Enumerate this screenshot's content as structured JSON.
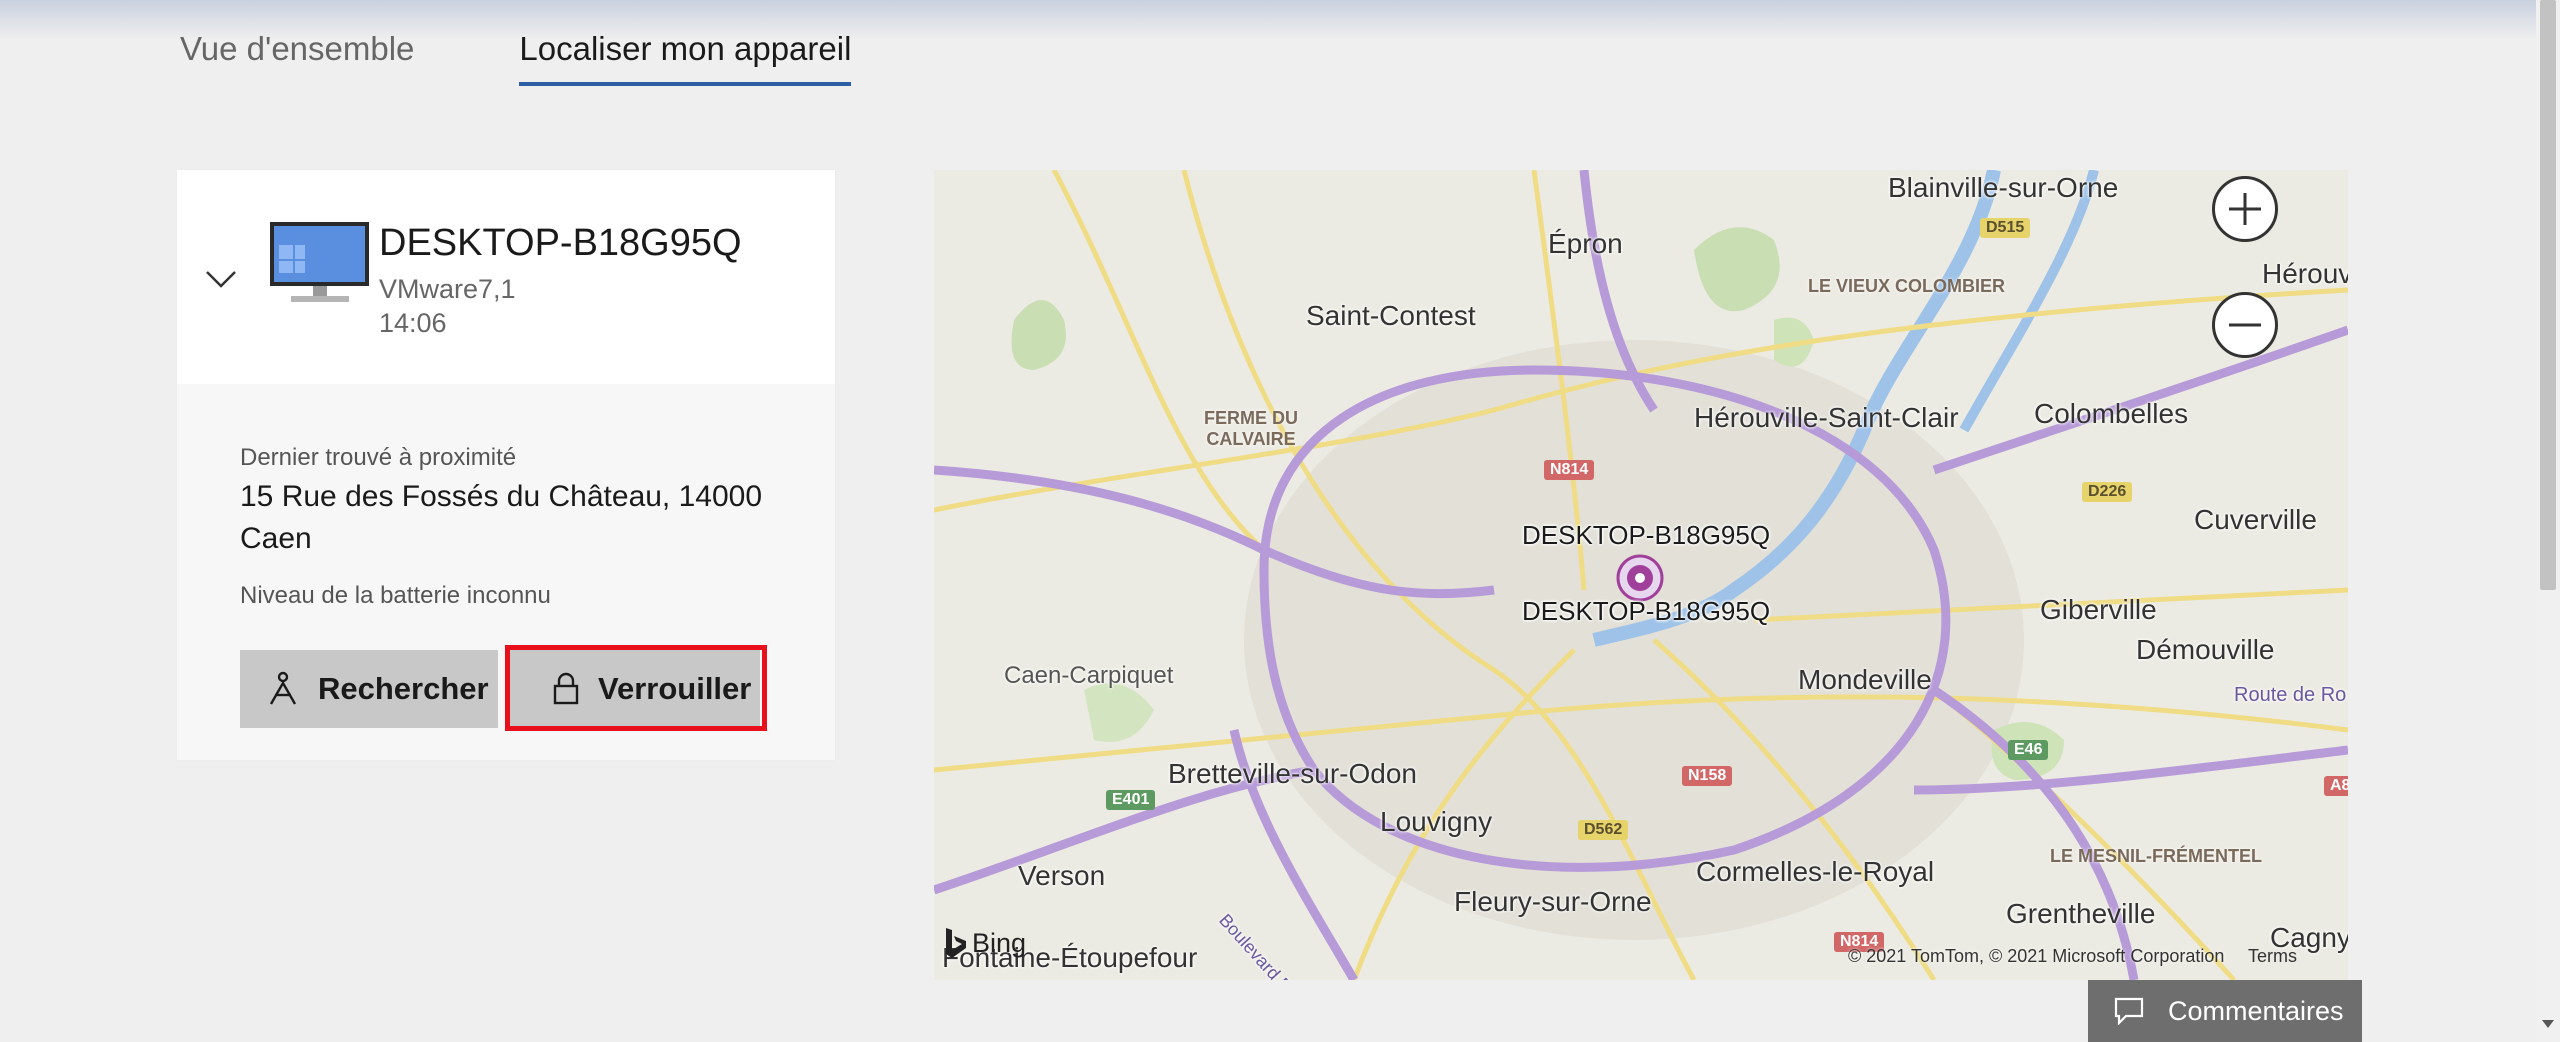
{
  "tabs": [
    {
      "label": "Vue d'ensemble",
      "active": false
    },
    {
      "label": "Localiser mon appareil",
      "active": true
    }
  ],
  "device": {
    "name": "DESKTOP-B18G95Q",
    "model": "VMware7,1",
    "time": "14:06",
    "icon": "desktop-pc-icon"
  },
  "location": {
    "found_label": "Dernier trouvé à proximité",
    "address": "15 Rue des Fossés du Château, 14000 Caen",
    "battery": "Niveau de la batterie inconnu"
  },
  "actions": {
    "search_label": "Rechercher",
    "lock_label": "Verrouiller"
  },
  "map": {
    "pin_label_top": "DESKTOP-B18G95Q",
    "pin_label_bottom": "DESKTOP-B18G95Q",
    "places": [
      "Blainville-sur-Orne",
      "Épron",
      "Saint-Contest",
      "Hérouv",
      "Hérouville-Saint-Clair",
      "Colombelles",
      "Cuverville",
      "Giberville",
      "Démouville",
      "Caen-Carpiquet",
      "Mondeville",
      "Bretteville-sur-Odon",
      "Louvigny",
      "Verson",
      "Fleury-sur-Orne",
      "Cormelles-le-Royal",
      "Grentheville",
      "Cagny",
      "Fontaine-Étoupefour"
    ],
    "districts": [
      "LE VIEUX COLOMBIER",
      "FERME DU CALVAIRE",
      "LE MESNIL-FRÉMENTEL"
    ],
    "roads": [
      "D515",
      "N814",
      "D226",
      "E46",
      "A8",
      "E401",
      "D562",
      "N158",
      "N814",
      "Route de Ro",
      "Boulevard Périphérique"
    ],
    "provider": "Bing",
    "copyright": "© 2021 TomTom, © 2021 Microsoft Corporation",
    "terms": "Terms",
    "zoom_in": "+",
    "zoom_out": "−"
  },
  "feedback": {
    "label": "Commentaires"
  },
  "colors": {
    "accent": "#2c5fa6",
    "highlight": "#e8101a",
    "pin": "#a0409a"
  }
}
